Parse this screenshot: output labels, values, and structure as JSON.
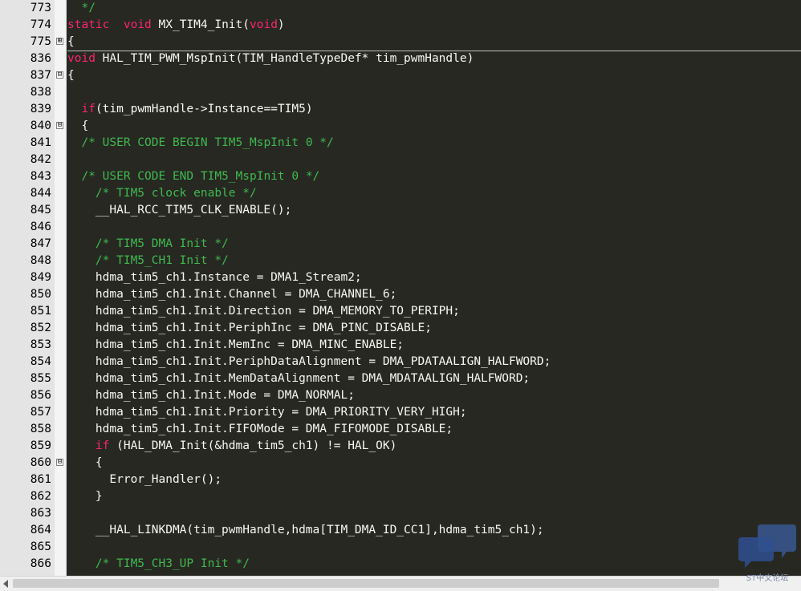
{
  "lines": [
    {
      "n": "773",
      "fold": "",
      "segs": [
        [
          "cm",
          "  */"
        ]
      ]
    },
    {
      "n": "774",
      "fold": "",
      "segs": [
        [
          "kw",
          "static"
        ],
        [
          "",
          "  "
        ],
        [
          "ty",
          "void"
        ],
        [
          "",
          " MX_TIM4_Init("
        ],
        [
          "ty",
          "void"
        ],
        [
          "",
          ")"
        ]
      ]
    },
    {
      "n": "775",
      "fold": "⊞",
      "segs": [
        [
          "",
          "{"
        ]
      ]
    },
    {
      "n": "836",
      "fold": "",
      "segs": [
        [
          "ty",
          "void"
        ],
        [
          "",
          " HAL_TIM_PWM_MspInit(TIM_HandleTypeDef* tim_pwmHandle)"
        ]
      ]
    },
    {
      "n": "837",
      "fold": "⊟",
      "segs": [
        [
          "",
          "{"
        ]
      ]
    },
    {
      "n": "838",
      "fold": "",
      "segs": []
    },
    {
      "n": "839",
      "fold": "",
      "segs": [
        [
          "",
          "  "
        ],
        [
          "kw",
          "if"
        ],
        [
          "",
          "(tim_pwmHandle->Instance==TIM5)"
        ]
      ]
    },
    {
      "n": "840",
      "fold": "⊟",
      "segs": [
        [
          "",
          "  {"
        ]
      ]
    },
    {
      "n": "841",
      "fold": "",
      "segs": [
        [
          "",
          "  "
        ],
        [
          "cm",
          "/* USER CODE BEGIN TIM5_MspInit 0 */"
        ]
      ]
    },
    {
      "n": "842",
      "fold": "",
      "segs": []
    },
    {
      "n": "843",
      "fold": "",
      "segs": [
        [
          "",
          "  "
        ],
        [
          "cm",
          "/* USER CODE END TIM5_MspInit 0 */"
        ]
      ]
    },
    {
      "n": "844",
      "fold": "",
      "segs": [
        [
          "",
          "    "
        ],
        [
          "cm",
          "/* TIM5 clock enable */"
        ]
      ]
    },
    {
      "n": "845",
      "fold": "",
      "segs": [
        [
          "",
          "    __HAL_RCC_TIM5_CLK_ENABLE();"
        ]
      ]
    },
    {
      "n": "846",
      "fold": "",
      "segs": []
    },
    {
      "n": "847",
      "fold": "",
      "segs": [
        [
          "",
          "    "
        ],
        [
          "cm",
          "/* TIM5 DMA Init */"
        ]
      ]
    },
    {
      "n": "848",
      "fold": "",
      "segs": [
        [
          "",
          "    "
        ],
        [
          "cm",
          "/* TIM5_CH1 Init */"
        ]
      ]
    },
    {
      "n": "849",
      "fold": "",
      "segs": [
        [
          "",
          "    hdma_tim5_ch1.Instance = DMA1_Stream2;"
        ]
      ]
    },
    {
      "n": "850",
      "fold": "",
      "segs": [
        [
          "",
          "    hdma_tim5_ch1.Init.Channel = DMA_CHANNEL_6;"
        ]
      ]
    },
    {
      "n": "851",
      "fold": "",
      "segs": [
        [
          "",
          "    hdma_tim5_ch1.Init.Direction = DMA_MEMORY_TO_PERIPH;"
        ]
      ]
    },
    {
      "n": "852",
      "fold": "",
      "segs": [
        [
          "",
          "    hdma_tim5_ch1.Init.PeriphInc = DMA_PINC_DISABLE;"
        ]
      ]
    },
    {
      "n": "853",
      "fold": "",
      "segs": [
        [
          "",
          "    hdma_tim5_ch1.Init.MemInc = DMA_MINC_ENABLE;"
        ]
      ]
    },
    {
      "n": "854",
      "fold": "",
      "segs": [
        [
          "",
          "    hdma_tim5_ch1.Init.PeriphDataAlignment = DMA_PDATAALIGN_HALFWORD;"
        ]
      ]
    },
    {
      "n": "855",
      "fold": "",
      "segs": [
        [
          "",
          "    hdma_tim5_ch1.Init.MemDataAlignment = DMA_MDATAALIGN_HALFWORD;"
        ]
      ]
    },
    {
      "n": "856",
      "fold": "",
      "segs": [
        [
          "",
          "    hdma_tim5_ch1.Init.Mode = DMA_NORMAL;"
        ]
      ]
    },
    {
      "n": "857",
      "fold": "",
      "segs": [
        [
          "",
          "    hdma_tim5_ch1.Init.Priority = DMA_PRIORITY_VERY_HIGH;"
        ]
      ]
    },
    {
      "n": "858",
      "fold": "",
      "segs": [
        [
          "",
          "    hdma_tim5_ch1.Init.FIFOMode = DMA_FIFOMODE_DISABLE;"
        ]
      ]
    },
    {
      "n": "859",
      "fold": "",
      "segs": [
        [
          "",
          "    "
        ],
        [
          "kw",
          "if"
        ],
        [
          "",
          " (HAL_DMA_Init(&hdma_tim5_ch1) != HAL_OK)"
        ]
      ]
    },
    {
      "n": "860",
      "fold": "⊟",
      "segs": [
        [
          "",
          "    {"
        ]
      ]
    },
    {
      "n": "861",
      "fold": "",
      "segs": [
        [
          "",
          "      Error_Handler();"
        ]
      ]
    },
    {
      "n": "862",
      "fold": "",
      "segs": [
        [
          "",
          "    }"
        ]
      ]
    },
    {
      "n": "863",
      "fold": "",
      "segs": []
    },
    {
      "n": "864",
      "fold": "",
      "segs": [
        [
          "",
          "    __HAL_LINKDMA(tim_pwmHandle,hdma[TIM_DMA_ID_CC1],hdma_tim5_ch1);"
        ]
      ]
    },
    {
      "n": "865",
      "fold": "",
      "segs": []
    },
    {
      "n": "866",
      "fold": "",
      "segs": [
        [
          "",
          "    "
        ],
        [
          "cm",
          "/* TIM5_CH3_UP Init */"
        ]
      ]
    }
  ],
  "watermark": {
    "text": "ST中文论坛"
  },
  "colors": {
    "background": "#272822",
    "keyword": "#f92672",
    "comment": "#3fb950",
    "text": "#f8f8f2",
    "gutter": "#e4e4e4"
  }
}
